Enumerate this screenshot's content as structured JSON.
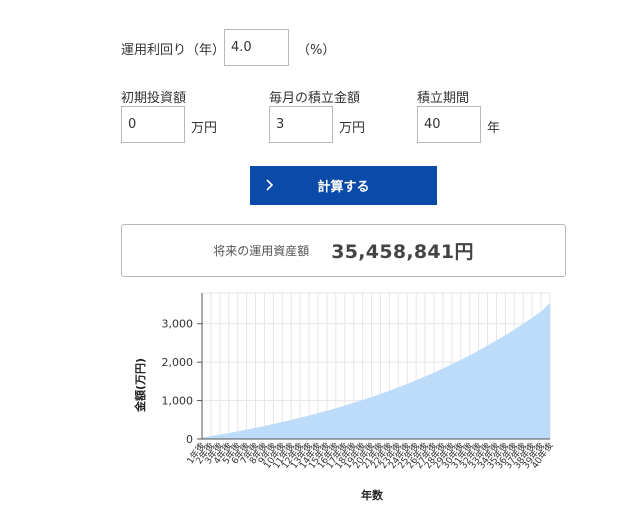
{
  "form": {
    "rate": {
      "label": "運用利回り（年）",
      "value": "4.0",
      "unit": "（%）"
    },
    "initial": {
      "label": "初期投資額",
      "value": "0",
      "unit": "万円"
    },
    "monthly": {
      "label": "毎月の積立金額",
      "value": "3",
      "unit": "万円"
    },
    "period": {
      "label": "積立期間",
      "value": "40",
      "unit": "年"
    }
  },
  "calc_button": {
    "label": "計算する",
    "icon": "chevron-right-icon"
  },
  "result": {
    "label": "将来の運用資産額",
    "value": "35,458,841円"
  },
  "colors": {
    "button": "#0a4aa8",
    "area": "#bcdcfa"
  },
  "chart_data": {
    "type": "area",
    "xlabel": "年数",
    "ylabel": "金額(万円)",
    "ylim": [
      0,
      3800
    ],
    "yticks": [
      0,
      1000,
      2000,
      3000
    ],
    "ytick_labels": [
      "0",
      "1,000",
      "2,000",
      "3,000"
    ],
    "grid": true,
    "categories": [
      "1年後",
      "2年後",
      "3年後",
      "4年後",
      "5年後",
      "6年後",
      "7年後",
      "8年後",
      "9年後",
      "10年後",
      "11年後",
      "12年後",
      "13年後",
      "14年後",
      "15年後",
      "16年後",
      "17年後",
      "18年後",
      "19年後",
      "20年後",
      "21年後",
      "22年後",
      "23年後",
      "24年後",
      "25年後",
      "26年後",
      "27年後",
      "28年後",
      "29年後",
      "30年後",
      "31年後",
      "32年後",
      "33年後",
      "34年後",
      "35年後",
      "36年後",
      "37年後",
      "38年後",
      "39年後",
      "40年後"
    ],
    "series": [
      {
        "values": [
          37,
          75,
          115,
          157,
          200,
          245,
          291,
          340,
          390,
          442,
          497,
          553,
          612,
          673,
          736,
          802,
          871,
          942,
          1016,
          1093,
          1173,
          1257,
          1344,
          1434,
          1528,
          1626,
          1728,
          1834,
          1944,
          2058,
          2177,
          2301,
          2430,
          2564,
          2703,
          2848,
          2999,
          3156,
          3319,
          3546
        ]
      }
    ]
  }
}
